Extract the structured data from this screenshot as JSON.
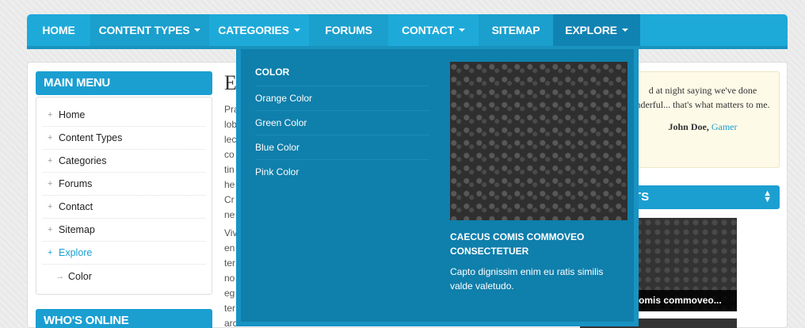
{
  "nav": {
    "items": [
      {
        "label": "HOME",
        "has_caret": false
      },
      {
        "label": "CONTENT TYPES",
        "has_caret": true
      },
      {
        "label": "CATEGORIES",
        "has_caret": true
      },
      {
        "label": "FORUMS",
        "has_caret": false
      },
      {
        "label": "CONTACT",
        "has_caret": true
      },
      {
        "label": "SITEMAP",
        "has_caret": false
      },
      {
        "label": "EXPLORE",
        "has_caret": true
      }
    ]
  },
  "dropdown": {
    "heading": "COLOR",
    "links": [
      "Orange Color",
      "Green Color",
      "Blue Color",
      "Pink Color"
    ],
    "feature_title": "CAECUS COMIS COMMOVEO CONSECTETUER",
    "feature_text": "Capto dignissim enim eu ratis similis valde valetudo."
  },
  "sidebar": {
    "main_menu_title": "MAIN MENU",
    "items": [
      {
        "label": "Home"
      },
      {
        "label": "Content Types"
      },
      {
        "label": "Categories"
      },
      {
        "label": "Forums"
      },
      {
        "label": "Contact"
      },
      {
        "label": "Sitemap"
      },
      {
        "label": "Explore"
      },
      {
        "label": "Color"
      }
    ],
    "whos_online_title": "WHO'S ONLINE"
  },
  "content": {
    "title": "Ex",
    "para1_lines": [
      "Pra",
      "lob",
      "lec",
      "co",
      "tin",
      "he",
      "Cr",
      "ne"
    ],
    "para2_lines": [
      "Viv",
      "en",
      "ter",
      "no",
      "eg",
      "ter",
      "arc"
    ]
  },
  "right": {
    "quote": "d at night saying we've done nderful... that's what matters to me.",
    "author": "John Doe,",
    "author_link": "Gamer",
    "block_title": "TS",
    "thumb_caption": "omis commoveo..."
  },
  "colors": {
    "nav_bg": "#1eaad9",
    "nav_active": "#1183b3",
    "dropdown_bg": "#0f7fab",
    "accent": "#1b9fd1"
  }
}
